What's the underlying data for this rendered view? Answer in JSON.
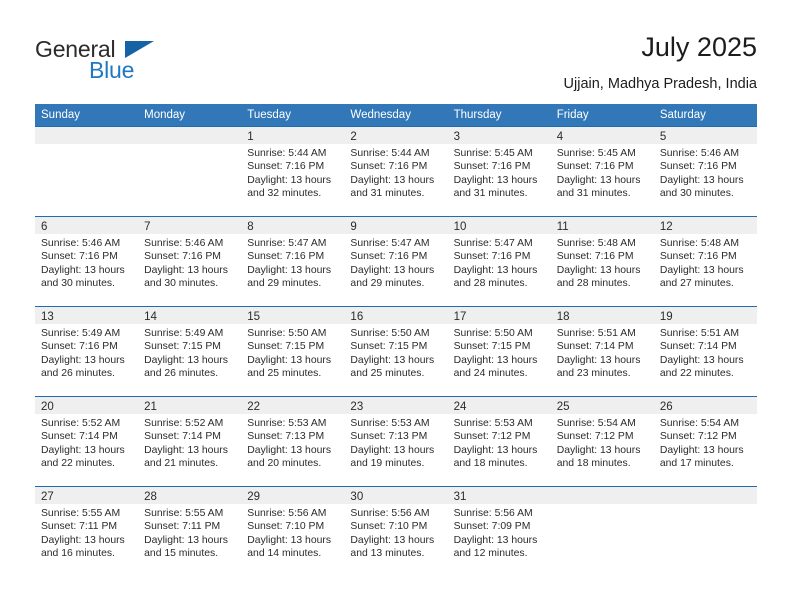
{
  "brand": {
    "name_part1": "General",
    "name_part2": "Blue",
    "triangle_color": "#1464a5",
    "blue_color": "#1f78c1"
  },
  "header": {
    "title": "July 2025",
    "subtitle": "Ujjain, Madhya Pradesh, India"
  },
  "theme": {
    "header_row_bg": "#3278b8",
    "row_divider": "#1f6cb0",
    "daynum_band_bg": "#efefef"
  },
  "weekdays": [
    "Sunday",
    "Monday",
    "Tuesday",
    "Wednesday",
    "Thursday",
    "Friday",
    "Saturday"
  ],
  "weeks": [
    [
      {
        "day": "",
        "empty": true
      },
      {
        "day": "",
        "empty": true
      },
      {
        "day": "1",
        "sunrise": "Sunrise: 5:44 AM",
        "sunset": "Sunset: 7:16 PM",
        "daylight1": "Daylight: 13 hours",
        "daylight2": "and 32 minutes."
      },
      {
        "day": "2",
        "sunrise": "Sunrise: 5:44 AM",
        "sunset": "Sunset: 7:16 PM",
        "daylight1": "Daylight: 13 hours",
        "daylight2": "and 31 minutes."
      },
      {
        "day": "3",
        "sunrise": "Sunrise: 5:45 AM",
        "sunset": "Sunset: 7:16 PM",
        "daylight1": "Daylight: 13 hours",
        "daylight2": "and 31 minutes."
      },
      {
        "day": "4",
        "sunrise": "Sunrise: 5:45 AM",
        "sunset": "Sunset: 7:16 PM",
        "daylight1": "Daylight: 13 hours",
        "daylight2": "and 31 minutes."
      },
      {
        "day": "5",
        "sunrise": "Sunrise: 5:46 AM",
        "sunset": "Sunset: 7:16 PM",
        "daylight1": "Daylight: 13 hours",
        "daylight2": "and 30 minutes."
      }
    ],
    [
      {
        "day": "6",
        "sunrise": "Sunrise: 5:46 AM",
        "sunset": "Sunset: 7:16 PM",
        "daylight1": "Daylight: 13 hours",
        "daylight2": "and 30 minutes."
      },
      {
        "day": "7",
        "sunrise": "Sunrise: 5:46 AM",
        "sunset": "Sunset: 7:16 PM",
        "daylight1": "Daylight: 13 hours",
        "daylight2": "and 30 minutes."
      },
      {
        "day": "8",
        "sunrise": "Sunrise: 5:47 AM",
        "sunset": "Sunset: 7:16 PM",
        "daylight1": "Daylight: 13 hours",
        "daylight2": "and 29 minutes."
      },
      {
        "day": "9",
        "sunrise": "Sunrise: 5:47 AM",
        "sunset": "Sunset: 7:16 PM",
        "daylight1": "Daylight: 13 hours",
        "daylight2": "and 29 minutes."
      },
      {
        "day": "10",
        "sunrise": "Sunrise: 5:47 AM",
        "sunset": "Sunset: 7:16 PM",
        "daylight1": "Daylight: 13 hours",
        "daylight2": "and 28 minutes."
      },
      {
        "day": "11",
        "sunrise": "Sunrise: 5:48 AM",
        "sunset": "Sunset: 7:16 PM",
        "daylight1": "Daylight: 13 hours",
        "daylight2": "and 28 minutes."
      },
      {
        "day": "12",
        "sunrise": "Sunrise: 5:48 AM",
        "sunset": "Sunset: 7:16 PM",
        "daylight1": "Daylight: 13 hours",
        "daylight2": "and 27 minutes."
      }
    ],
    [
      {
        "day": "13",
        "sunrise": "Sunrise: 5:49 AM",
        "sunset": "Sunset: 7:16 PM",
        "daylight1": "Daylight: 13 hours",
        "daylight2": "and 26 minutes."
      },
      {
        "day": "14",
        "sunrise": "Sunrise: 5:49 AM",
        "sunset": "Sunset: 7:15 PM",
        "daylight1": "Daylight: 13 hours",
        "daylight2": "and 26 minutes."
      },
      {
        "day": "15",
        "sunrise": "Sunrise: 5:50 AM",
        "sunset": "Sunset: 7:15 PM",
        "daylight1": "Daylight: 13 hours",
        "daylight2": "and 25 minutes."
      },
      {
        "day": "16",
        "sunrise": "Sunrise: 5:50 AM",
        "sunset": "Sunset: 7:15 PM",
        "daylight1": "Daylight: 13 hours",
        "daylight2": "and 25 minutes."
      },
      {
        "day": "17",
        "sunrise": "Sunrise: 5:50 AM",
        "sunset": "Sunset: 7:15 PM",
        "daylight1": "Daylight: 13 hours",
        "daylight2": "and 24 minutes."
      },
      {
        "day": "18",
        "sunrise": "Sunrise: 5:51 AM",
        "sunset": "Sunset: 7:14 PM",
        "daylight1": "Daylight: 13 hours",
        "daylight2": "and 23 minutes."
      },
      {
        "day": "19",
        "sunrise": "Sunrise: 5:51 AM",
        "sunset": "Sunset: 7:14 PM",
        "daylight1": "Daylight: 13 hours",
        "daylight2": "and 22 minutes."
      }
    ],
    [
      {
        "day": "20",
        "sunrise": "Sunrise: 5:52 AM",
        "sunset": "Sunset: 7:14 PM",
        "daylight1": "Daylight: 13 hours",
        "daylight2": "and 22 minutes."
      },
      {
        "day": "21",
        "sunrise": "Sunrise: 5:52 AM",
        "sunset": "Sunset: 7:14 PM",
        "daylight1": "Daylight: 13 hours",
        "daylight2": "and 21 minutes."
      },
      {
        "day": "22",
        "sunrise": "Sunrise: 5:53 AM",
        "sunset": "Sunset: 7:13 PM",
        "daylight1": "Daylight: 13 hours",
        "daylight2": "and 20 minutes."
      },
      {
        "day": "23",
        "sunrise": "Sunrise: 5:53 AM",
        "sunset": "Sunset: 7:13 PM",
        "daylight1": "Daylight: 13 hours",
        "daylight2": "and 19 minutes."
      },
      {
        "day": "24",
        "sunrise": "Sunrise: 5:53 AM",
        "sunset": "Sunset: 7:12 PM",
        "daylight1": "Daylight: 13 hours",
        "daylight2": "and 18 minutes."
      },
      {
        "day": "25",
        "sunrise": "Sunrise: 5:54 AM",
        "sunset": "Sunset: 7:12 PM",
        "daylight1": "Daylight: 13 hours",
        "daylight2": "and 18 minutes."
      },
      {
        "day": "26",
        "sunrise": "Sunrise: 5:54 AM",
        "sunset": "Sunset: 7:12 PM",
        "daylight1": "Daylight: 13 hours",
        "daylight2": "and 17 minutes."
      }
    ],
    [
      {
        "day": "27",
        "sunrise": "Sunrise: 5:55 AM",
        "sunset": "Sunset: 7:11 PM",
        "daylight1": "Daylight: 13 hours",
        "daylight2": "and 16 minutes."
      },
      {
        "day": "28",
        "sunrise": "Sunrise: 5:55 AM",
        "sunset": "Sunset: 7:11 PM",
        "daylight1": "Daylight: 13 hours",
        "daylight2": "and 15 minutes."
      },
      {
        "day": "29",
        "sunrise": "Sunrise: 5:56 AM",
        "sunset": "Sunset: 7:10 PM",
        "daylight1": "Daylight: 13 hours",
        "daylight2": "and 14 minutes."
      },
      {
        "day": "30",
        "sunrise": "Sunrise: 5:56 AM",
        "sunset": "Sunset: 7:10 PM",
        "daylight1": "Daylight: 13 hours",
        "daylight2": "and 13 minutes."
      },
      {
        "day": "31",
        "sunrise": "Sunrise: 5:56 AM",
        "sunset": "Sunset: 7:09 PM",
        "daylight1": "Daylight: 13 hours",
        "daylight2": "and 12 minutes."
      },
      {
        "day": "",
        "empty": true
      },
      {
        "day": "",
        "empty": true
      }
    ]
  ]
}
